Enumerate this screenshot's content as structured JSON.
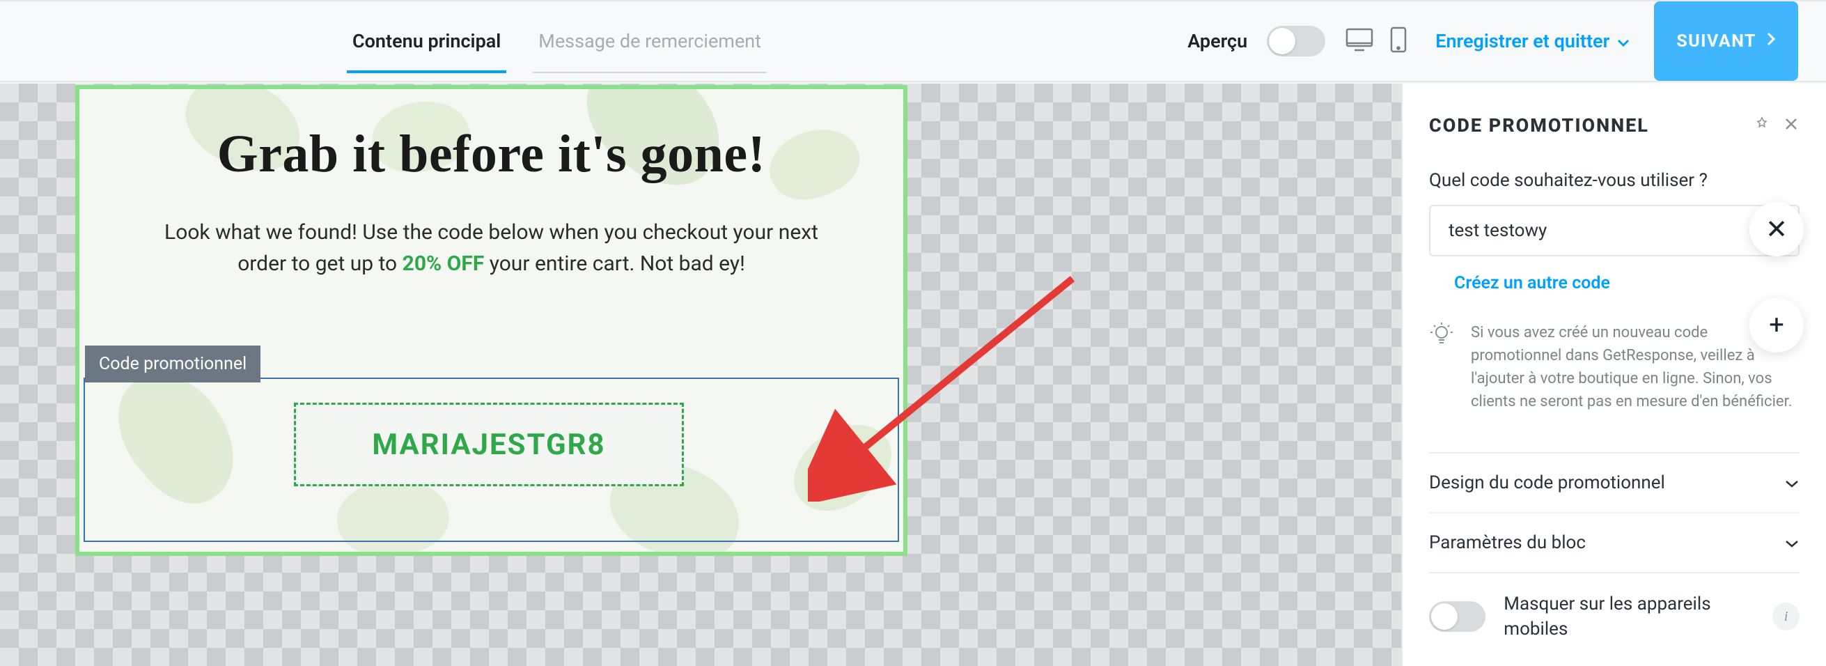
{
  "topbar": {
    "tabs": {
      "main": "Contenu principal",
      "thanks": "Message de remerciement"
    },
    "preview_label": "Aperçu",
    "save_exit": "Enregistrer et quitter",
    "next": "SUIVANT"
  },
  "popup": {
    "headline": "Grab it before it's gone!",
    "sub_before": "Look what we found! Use the code below when you checkout your next order to get up to ",
    "sub_highlight": "20% OFF",
    "sub_after": " your entire cart. Not bad ey!",
    "block_tag": "Code promotionnel",
    "code": "MARIAJESTGR8"
  },
  "panel": {
    "title": "CODE PROMOTIONNEL",
    "which_code": "Quel code souhaitez-vous utiliser ?",
    "selected_code": "test testowy",
    "create_another": "Créez un autre code",
    "tip": "Si vous avez créé un nouveau code promotionnel dans GetResponse, veillez à l'ajouter à votre boutique en ligne. Sinon, vos clients ne seront pas en mesure d'en bénéficier.",
    "accordion": {
      "design": "Design du code promotionnel",
      "block_settings": "Paramètres du bloc"
    },
    "hide_mobile": "Masquer sur les appareils mobiles"
  },
  "float_buttons": {
    "close": "✕",
    "add": "+"
  },
  "colors": {
    "accent_blue": "#00a0ff",
    "accent_green": "#2fa84a",
    "selection_border": "#3b6fb5",
    "popup_border": "#8be08a"
  }
}
